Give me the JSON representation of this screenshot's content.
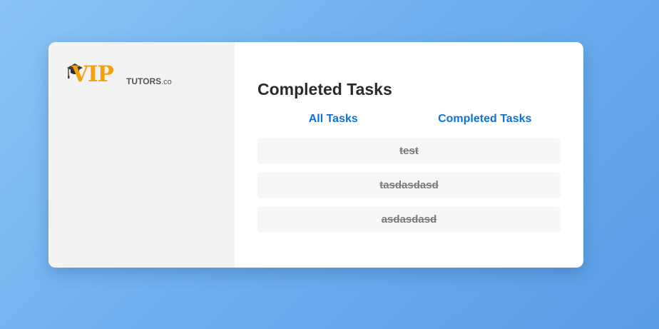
{
  "logo": {
    "brand_main": "VIP",
    "brand_sub": "TUTORS",
    "brand_domain": ".co",
    "colors": {
      "orange": "#f5a010",
      "gray": "#555555"
    }
  },
  "header": {
    "title": "Completed Tasks"
  },
  "tabs": [
    {
      "label": "All Tasks"
    },
    {
      "label": "Completed Tasks"
    }
  ],
  "tasks": [
    {
      "text": "test",
      "completed": true
    },
    {
      "text": "tasdasdasd",
      "completed": true
    },
    {
      "text": "asdasdasd",
      "completed": true
    }
  ],
  "colors": {
    "accent": "#0b72d9",
    "completed_text": "#7a7a7a",
    "card_bg": "#ffffff",
    "sidebar_bg": "#f3f3f3"
  }
}
